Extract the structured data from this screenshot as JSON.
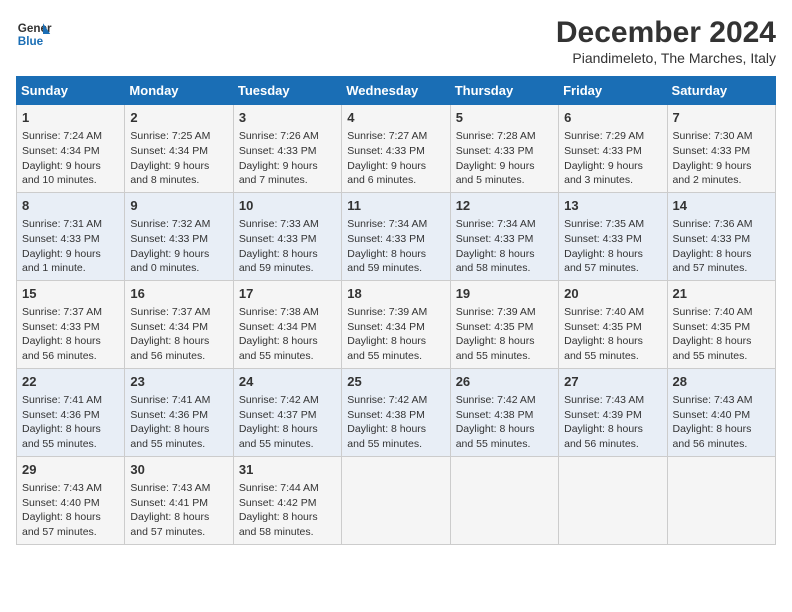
{
  "header": {
    "logo_line1": "General",
    "logo_line2": "Blue",
    "title": "December 2024",
    "subtitle": "Piandimeleto, The Marches, Italy"
  },
  "weekdays": [
    "Sunday",
    "Monday",
    "Tuesday",
    "Wednesday",
    "Thursday",
    "Friday",
    "Saturday"
  ],
  "weeks": [
    [
      {
        "day": "1",
        "info": "Sunrise: 7:24 AM\nSunset: 4:34 PM\nDaylight: 9 hours and 10 minutes."
      },
      {
        "day": "2",
        "info": "Sunrise: 7:25 AM\nSunset: 4:34 PM\nDaylight: 9 hours and 8 minutes."
      },
      {
        "day": "3",
        "info": "Sunrise: 7:26 AM\nSunset: 4:33 PM\nDaylight: 9 hours and 7 minutes."
      },
      {
        "day": "4",
        "info": "Sunrise: 7:27 AM\nSunset: 4:33 PM\nDaylight: 9 hours and 6 minutes."
      },
      {
        "day": "5",
        "info": "Sunrise: 7:28 AM\nSunset: 4:33 PM\nDaylight: 9 hours and 5 minutes."
      },
      {
        "day": "6",
        "info": "Sunrise: 7:29 AM\nSunset: 4:33 PM\nDaylight: 9 hours and 3 minutes."
      },
      {
        "day": "7",
        "info": "Sunrise: 7:30 AM\nSunset: 4:33 PM\nDaylight: 9 hours and 2 minutes."
      }
    ],
    [
      {
        "day": "8",
        "info": "Sunrise: 7:31 AM\nSunset: 4:33 PM\nDaylight: 9 hours and 1 minute."
      },
      {
        "day": "9",
        "info": "Sunrise: 7:32 AM\nSunset: 4:33 PM\nDaylight: 9 hours and 0 minutes."
      },
      {
        "day": "10",
        "info": "Sunrise: 7:33 AM\nSunset: 4:33 PM\nDaylight: 8 hours and 59 minutes."
      },
      {
        "day": "11",
        "info": "Sunrise: 7:34 AM\nSunset: 4:33 PM\nDaylight: 8 hours and 59 minutes."
      },
      {
        "day": "12",
        "info": "Sunrise: 7:34 AM\nSunset: 4:33 PM\nDaylight: 8 hours and 58 minutes."
      },
      {
        "day": "13",
        "info": "Sunrise: 7:35 AM\nSunset: 4:33 PM\nDaylight: 8 hours and 57 minutes."
      },
      {
        "day": "14",
        "info": "Sunrise: 7:36 AM\nSunset: 4:33 PM\nDaylight: 8 hours and 57 minutes."
      }
    ],
    [
      {
        "day": "15",
        "info": "Sunrise: 7:37 AM\nSunset: 4:33 PM\nDaylight: 8 hours and 56 minutes."
      },
      {
        "day": "16",
        "info": "Sunrise: 7:37 AM\nSunset: 4:34 PM\nDaylight: 8 hours and 56 minutes."
      },
      {
        "day": "17",
        "info": "Sunrise: 7:38 AM\nSunset: 4:34 PM\nDaylight: 8 hours and 55 minutes."
      },
      {
        "day": "18",
        "info": "Sunrise: 7:39 AM\nSunset: 4:34 PM\nDaylight: 8 hours and 55 minutes."
      },
      {
        "day": "19",
        "info": "Sunrise: 7:39 AM\nSunset: 4:35 PM\nDaylight: 8 hours and 55 minutes."
      },
      {
        "day": "20",
        "info": "Sunrise: 7:40 AM\nSunset: 4:35 PM\nDaylight: 8 hours and 55 minutes."
      },
      {
        "day": "21",
        "info": "Sunrise: 7:40 AM\nSunset: 4:35 PM\nDaylight: 8 hours and 55 minutes."
      }
    ],
    [
      {
        "day": "22",
        "info": "Sunrise: 7:41 AM\nSunset: 4:36 PM\nDaylight: 8 hours and 55 minutes."
      },
      {
        "day": "23",
        "info": "Sunrise: 7:41 AM\nSunset: 4:36 PM\nDaylight: 8 hours and 55 minutes."
      },
      {
        "day": "24",
        "info": "Sunrise: 7:42 AM\nSunset: 4:37 PM\nDaylight: 8 hours and 55 minutes."
      },
      {
        "day": "25",
        "info": "Sunrise: 7:42 AM\nSunset: 4:38 PM\nDaylight: 8 hours and 55 minutes."
      },
      {
        "day": "26",
        "info": "Sunrise: 7:42 AM\nSunset: 4:38 PM\nDaylight: 8 hours and 55 minutes."
      },
      {
        "day": "27",
        "info": "Sunrise: 7:43 AM\nSunset: 4:39 PM\nDaylight: 8 hours and 56 minutes."
      },
      {
        "day": "28",
        "info": "Sunrise: 7:43 AM\nSunset: 4:40 PM\nDaylight: 8 hours and 56 minutes."
      }
    ],
    [
      {
        "day": "29",
        "info": "Sunrise: 7:43 AM\nSunset: 4:40 PM\nDaylight: 8 hours and 57 minutes."
      },
      {
        "day": "30",
        "info": "Sunrise: 7:43 AM\nSunset: 4:41 PM\nDaylight: 8 hours and 57 minutes."
      },
      {
        "day": "31",
        "info": "Sunrise: 7:44 AM\nSunset: 4:42 PM\nDaylight: 8 hours and 58 minutes."
      },
      null,
      null,
      null,
      null
    ]
  ]
}
